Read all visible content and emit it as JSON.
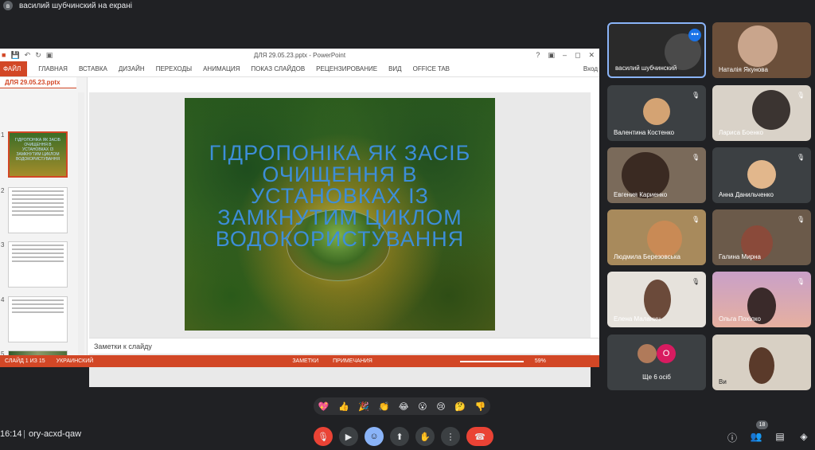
{
  "presenter_bar": {
    "avatar_letter": "в",
    "text": "василий шубчинский на екрані"
  },
  "ppt": {
    "window_title": "ДЛЯ 29.05.23.pptx - PowerPoint",
    "ribbon": {
      "file": "ФАЙЛ",
      "tabs": [
        "ГЛАВНАЯ",
        "ВСТАВКА",
        "ДИЗАЙН",
        "ПЕРЕХОДЫ",
        "АНИМАЦИЯ",
        "ПОКАЗ СЛАЙДОВ",
        "РЕЦЕНЗИРОВАНИЕ",
        "ВИД",
        "OFFICE TAB"
      ],
      "login": "Вход"
    },
    "doc_tab": "ДЛЯ 29.05.23.pptx",
    "thumb_numbers": [
      "1",
      "2",
      "3",
      "4",
      "5"
    ],
    "thumb1_text": "ГІДРОПОНІКА ЯК ЗАСІБ ОЧИЩЕННЯ В УСТАНОВКАХ ІЗ ЗАМКНУТИМ ЦИКЛОМ ВОДОКОРИСТУВАННЯ",
    "slide_title": "ГІДРОПОНІКА ЯК ЗАСІБ ОЧИЩЕННЯ В УСТАНОВКАХ ІЗ  ЗАМКНУТИМ ЦИКЛОМ ВОДОКОРИСТУВАННЯ",
    "notes_placeholder": "Заметки к слайду",
    "status": {
      "slide": "СЛАЙД 1 ИЗ 15",
      "lang": "УКРАИНСКИЙ",
      "notes": "ЗАМЕТКИ",
      "comments": "ПРИМЕЧАНИЯ",
      "zoom": "59%"
    }
  },
  "participants": [
    {
      "name": "василий шубчинский",
      "muted": false,
      "active": true
    },
    {
      "name": "Наталія Якунова",
      "muted": false
    },
    {
      "name": "Валентина Костенко",
      "muted": true
    },
    {
      "name": "Лариса Боенко",
      "muted": true
    },
    {
      "name": "Евгения Кариенко",
      "muted": true
    },
    {
      "name": "Анна Данильченко",
      "muted": true
    },
    {
      "name": "Людмила Березовська",
      "muted": true
    },
    {
      "name": "Галина Мирна",
      "muted": true
    },
    {
      "name": "Елена Маланич",
      "muted": true
    },
    {
      "name": "Ольга Похілко",
      "muted": true
    },
    {
      "name": "Ще 6 осіб",
      "others_letter": "O"
    },
    {
      "name": "Ви",
      "muted": false
    }
  ],
  "bottom": {
    "time": "16:14",
    "meeting_code": "ory-acxd-qaw",
    "people_count": "18",
    "reactions": [
      "💖",
      "👍",
      "🎉",
      "👏",
      "😂",
      "😮",
      "😢",
      "🤔",
      "👎"
    ],
    "icons": [
      "mic-off-icon",
      "camera-off-icon",
      "emoji-icon",
      "present-icon",
      "raise-hand-icon",
      "more-icon",
      "end-call-icon"
    ]
  },
  "colors": {
    "accent": "#1a73e8",
    "ppt_orange": "#d24726",
    "end_call": "#ea4335"
  }
}
